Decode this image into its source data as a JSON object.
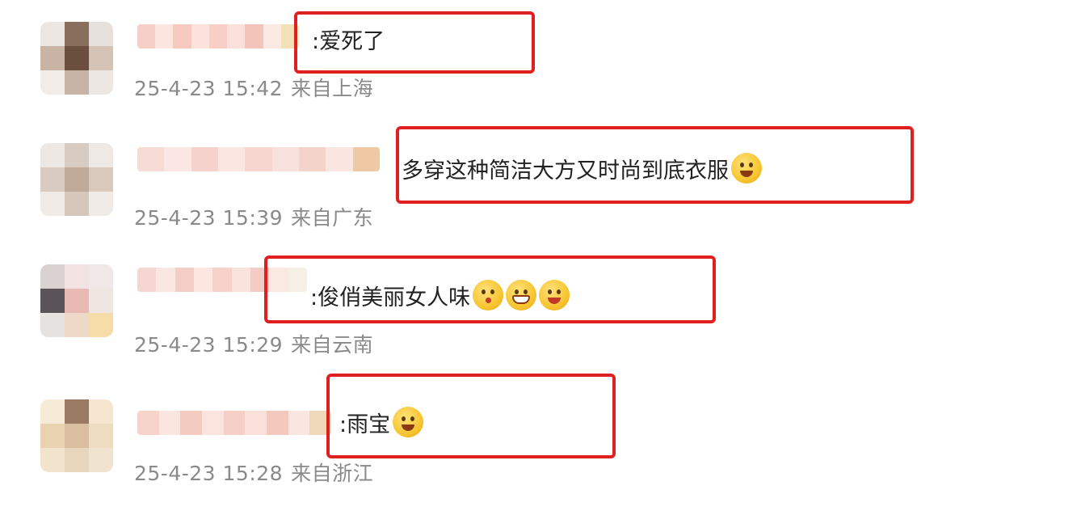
{
  "comments": [
    {
      "text": ":爱死了",
      "emojis": [],
      "time": "25-4-23 15:42",
      "location": "来自上海",
      "highlighted": true,
      "avatar_colors": [
        "#ece7e2",
        "#8a6e5c",
        "#e6e1dc",
        "#c9b3a4",
        "#6b4f3e",
        "#d5c3b6",
        "#f1ece8",
        "#c7b4a5",
        "#ece7e2"
      ],
      "name_colors": [
        "#f6d0c8",
        "#fbe5df",
        "#f5c9c0",
        "#fbe3dc",
        "#f7cfc6",
        "#f9e0d9",
        "#f3c4ba",
        "#fae8e2",
        "#f1e0b8"
      ]
    },
    {
      "text": "多穿这种简洁大方又时尚到底衣服",
      "emojis": [
        "thinking-emoji"
      ],
      "time": "25-4-23 15:39",
      "location": "来自广东",
      "highlighted": true,
      "avatar_colors": [
        "#eee8e4",
        "#d8cbc1",
        "#efe9e5",
        "#dacbc0",
        "#bfaa9a",
        "#d9c8bc",
        "#f0ebe7",
        "#d7c7bb",
        "#f0ebe7"
      ],
      "name_colors": [
        "#f7dcd6",
        "#fae7e3",
        "#f5d2cb",
        "#fbe6e1",
        "#f6d6cf",
        "#f8e1dc",
        "#f4d3cb",
        "#fae6e0",
        "#efc9a4"
      ]
    },
    {
      "text": ":俊俏美丽女人味",
      "emojis": [
        "kiss-emoji",
        "grin-emoji",
        "tongue-emoji"
      ],
      "time": "25-4-23 15:29",
      "location": "来自云南",
      "highlighted": true,
      "avatar_colors": [
        "#d9d2d0",
        "#f3e2e2",
        "#f0e8e6",
        "#5a5458",
        "#e8b9b3",
        "#efe6e2",
        "#e6e2e0",
        "#eed8c8",
        "#f6dca8"
      ],
      "name_colors": [
        "#f6d6d0",
        "#fbe7e2",
        "#f4cec6",
        "#fbe6e0",
        "#f6d2ca",
        "#f9e3dd",
        "#f3cdc5",
        "#fae8e2",
        "#f5efe6"
      ]
    },
    {
      "text": ":雨宝",
      "emojis": [
        "blush-emoji"
      ],
      "time": "25-4-23 15:28",
      "location": "来自浙江",
      "highlighted": true,
      "avatar_colors": [
        "#f6ebd6",
        "#9a7a62",
        "#f6e6cf",
        "#e9d2b0",
        "#d9bfa0",
        "#eddcc2",
        "#f2e4cc",
        "#e8d6bc",
        "#f0e3cf"
      ],
      "name_colors": [
        "#f6d4cb",
        "#fbe5df",
        "#f4cbc1",
        "#fae4dd",
        "#f6d0c7",
        "#f9e1da",
        "#f3c9be",
        "#fae6e0",
        "#efd8b8"
      ]
    }
  ]
}
